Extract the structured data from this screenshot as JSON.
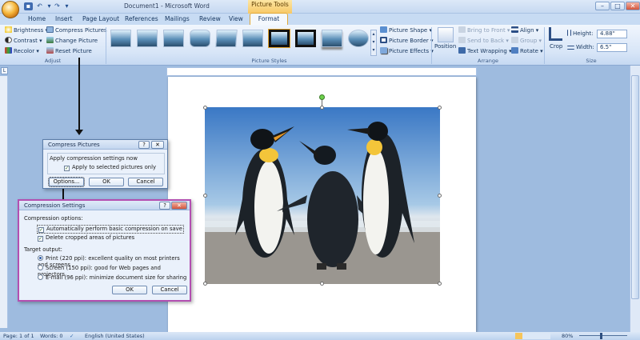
{
  "window": {
    "title": "Document1 - Microsoft Word",
    "context_tab": "Picture Tools",
    "controls": [
      "–",
      "□",
      "✕"
    ]
  },
  "tabs": [
    "Home",
    "Insert",
    "Page Layout",
    "References",
    "Mailings",
    "Review",
    "View",
    "Format"
  ],
  "ribbon": {
    "adjust": {
      "label": "Adjust",
      "brightness": "Brightness",
      "contrast": "Contrast",
      "recolor": "Recolor",
      "compress": "Compress Pictures",
      "change": "Change Picture",
      "reset": "Reset Picture"
    },
    "styles": {
      "label": "Picture Styles",
      "shape": "Picture Shape",
      "border": "Picture Border",
      "effects": "Picture Effects"
    },
    "arrange": {
      "label": "Arrange",
      "position": "Position",
      "bring_front": "Bring to Front",
      "send_back": "Send to Back",
      "text_wrap": "Text Wrapping",
      "align": "Align",
      "group": "Group",
      "rotate": "Rotate"
    },
    "size": {
      "label": "Size",
      "crop": "Crop",
      "height_label": "Height:",
      "height_value": "4.88\"",
      "width_label": "Width:",
      "width_value": "6.5\""
    }
  },
  "compress_dialog": {
    "title": "Compress Pictures",
    "help": "?",
    "close": "✕",
    "group_label": "Apply compression settings now",
    "checkbox_label": "Apply to selected pictures only",
    "checkbox_checked": true,
    "options_button": "Options...",
    "ok_button": "OK",
    "cancel_button": "Cancel"
  },
  "settings_dialog": {
    "title": "Compression Settings",
    "help": "?",
    "close": "✕",
    "options_label": "Compression options:",
    "option1": "Automatically perform basic compression on save",
    "option1_checked": true,
    "option2": "Delete cropped areas of pictures",
    "option2_checked": true,
    "target_label": "Target output:",
    "radio1": "Print (220 ppi): excellent quality on most printers and screens",
    "radio2": "Screen (150 ppi): good for Web pages and projectors",
    "radio3": "E-mail (96 ppi): minimize document size for sharing",
    "selected_radio": "print",
    "ok_button": "OK",
    "cancel_button": "Cancel"
  },
  "status_bar": {
    "page": "Page: 1 of 1",
    "words": "Words: 0",
    "language": "English (United States)",
    "zoom": "80%"
  }
}
